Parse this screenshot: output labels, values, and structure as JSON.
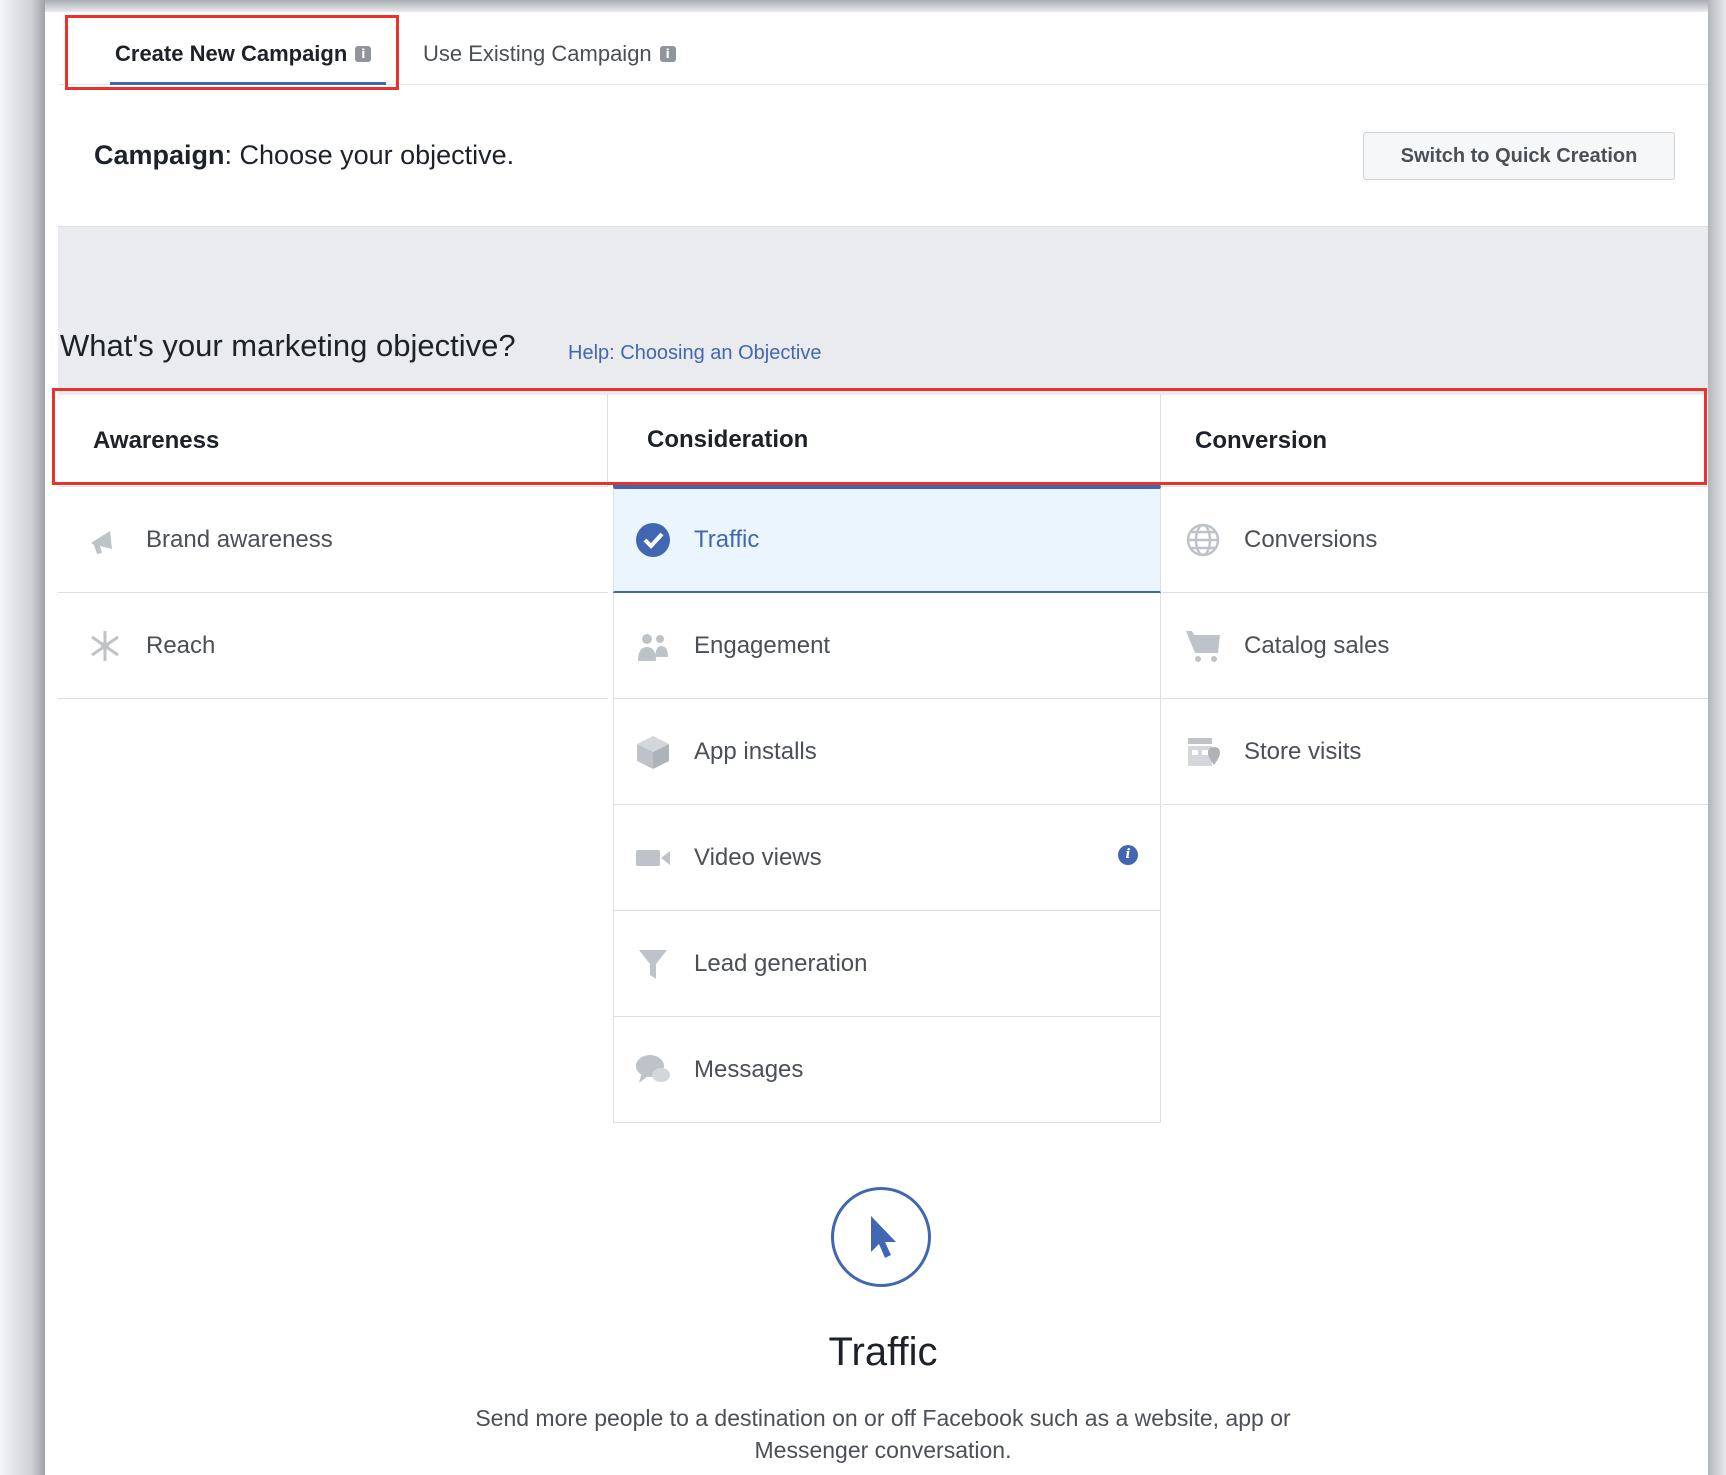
{
  "tabs": [
    {
      "label": "Create New Campaign",
      "active": true
    },
    {
      "label": "Use Existing Campaign",
      "active": false
    }
  ],
  "campaign": {
    "label": "Campaign",
    "text": ": Choose your objective."
  },
  "quick_button": "Switch to Quick Creation",
  "question": "What's your marketing objective?",
  "help_link": "Help: Choosing an Objective",
  "columns": [
    {
      "title": "Awareness",
      "items": [
        {
          "label": "Brand awareness",
          "icon": "megaphone-icon"
        },
        {
          "label": "Reach",
          "icon": "reach-icon"
        }
      ]
    },
    {
      "title": "Consideration",
      "items": [
        {
          "label": "Traffic",
          "icon": "check-circle-icon",
          "selected": true
        },
        {
          "label": "Engagement",
          "icon": "people-icon"
        },
        {
          "label": "App installs",
          "icon": "box-icon"
        },
        {
          "label": "Video views",
          "icon": "video-camera-icon",
          "info": true
        },
        {
          "label": "Lead generation",
          "icon": "funnel-icon"
        },
        {
          "label": "Messages",
          "icon": "chat-bubbles-icon"
        }
      ]
    },
    {
      "title": "Conversion",
      "items": [
        {
          "label": "Conversions",
          "icon": "globe-icon"
        },
        {
          "label": "Catalog sales",
          "icon": "cart-icon"
        },
        {
          "label": "Store visits",
          "icon": "store-icon"
        }
      ]
    }
  ],
  "detail": {
    "title": "Traffic",
    "icon": "cursor-icon",
    "description": "Send more people to a destination on or off Facebook such as a website, app or Messenger conversation."
  },
  "colors": {
    "accent": "#4267b2",
    "highlight": "#e8322a",
    "selected_bg": "#ebf5fd"
  }
}
